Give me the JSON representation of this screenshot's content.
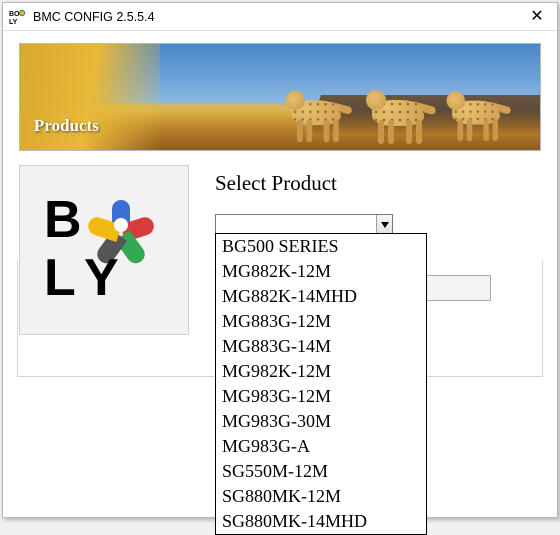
{
  "window": {
    "title": "BMC CONFIG 2.5.5.4",
    "close_glyph": "✕"
  },
  "banner": {
    "label": "Products"
  },
  "logo": {
    "text_B": "B",
    "text_L": "L",
    "text_Y": "Y"
  },
  "select": {
    "label": "Select Product",
    "value": "",
    "options": [
      "BG500 SERIES",
      "MG882K-12M",
      "MG882K-14MHD",
      "MG883G-12M",
      "MG883G-14M",
      "MG982K-12M",
      "MG983G-12M",
      "MG983G-30M",
      "MG983G-A",
      "SG550M-12M",
      "SG880MK-12M",
      "SG880MK-14MHD"
    ]
  }
}
